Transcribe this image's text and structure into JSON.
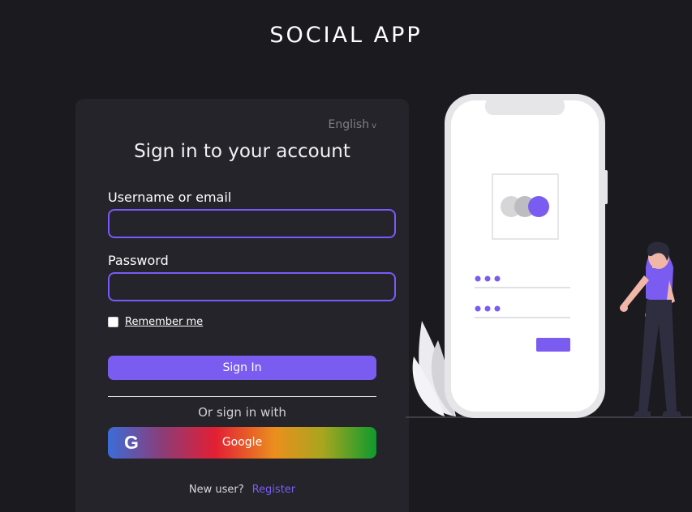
{
  "header": {
    "title": "SOCIAL APP"
  },
  "login": {
    "language": "English",
    "language_chevron": "v",
    "title": "Sign in to your account",
    "username_label": "Username or email",
    "username_value": "",
    "password_label": "Password",
    "password_value": "",
    "remember_label": "Remember me",
    "signin_label": "Sign In",
    "or_text": "Or sign in with",
    "google_icon": "G",
    "google_label": "Google",
    "new_user_text": "New user?",
    "register_label": "Register"
  },
  "colors": {
    "background": "#1b1a1f",
    "card": "#24242a",
    "accent": "#7b5cf0"
  }
}
